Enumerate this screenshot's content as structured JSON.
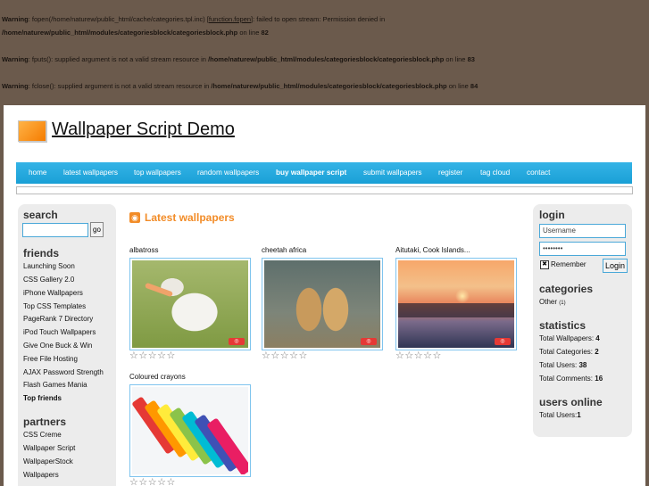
{
  "warnings": [
    {
      "label": "Warning",
      "text1": ": fopen(/home/naturew/public_html/cache/categories.tpl.inc) [",
      "link": "function.fopen",
      "text2": "]: failed to open stream: Permission denied in",
      "path": "/home/naturew/public_html/modules/categoriesblock/categoriesblock.php",
      "line_text": " on line ",
      "line": "82"
    },
    {
      "label": "Warning",
      "text1": ": fputs(): supplied argument is not a valid stream resource in ",
      "path": "/home/naturew/public_html/modules/categoriesblock/categoriesblock.php",
      "line_text": " on line ",
      "line": "83"
    },
    {
      "label": "Warning",
      "text1": ": fclose(): supplied argument is not a valid stream resource in ",
      "path": "/home/naturew/public_html/modules/categoriesblock/categoriesblock.php",
      "line_text": " on line ",
      "line": "84"
    }
  ],
  "site_title": "Wallpaper Script Demo",
  "nav": [
    "home",
    "latest wallpapers",
    "top wallpapers",
    "random wallpapers",
    "buy wallpaper script",
    "submit wallpapers",
    "register",
    "tag cloud",
    "contact"
  ],
  "left": {
    "search_heading": "search",
    "go_label": "go",
    "friends_heading": "friends",
    "friends": [
      "Launching Soon",
      "CSS Gallery 2.0",
      "iPhone Wallpapers",
      "Top CSS Templates",
      "PageRank 7 Directory",
      "iPod Touch Wallpapers",
      "Give One Buck & Win",
      "Free File Hosting",
      "AJAX Password Strength",
      "Flash Games Mania",
      "Top friends"
    ],
    "partners_heading": "partners",
    "partners": [
      "CSS Creme",
      "Wallpaper Script",
      "WallpaperStock",
      "Wallpapers"
    ]
  },
  "main": {
    "title": "Latest wallpapers",
    "rss_icon": "rss-icon",
    "wallpapers": [
      {
        "title": "albatross",
        "rating_stars": "☆☆☆☆☆"
      },
      {
        "title": "cheetah africa",
        "rating_stars": "☆☆☆☆☆"
      },
      {
        "title": "Aitutaki, Cook Islands...",
        "rating_stars": "☆☆☆☆☆"
      },
      {
        "title": "Coloured crayons",
        "rating_stars": "☆☆☆☆☆"
      }
    ]
  },
  "right": {
    "login_heading": "login",
    "username_value": "Username",
    "password_value": "••••••••",
    "checkbox_mark": "✖",
    "remember_label": "Remember",
    "login_button": "Login",
    "categories_heading": "categories",
    "category": {
      "name": "Other",
      "count": "(1)"
    },
    "statistics_heading": "statistics",
    "stats": [
      {
        "label": "Total Wallpapers: ",
        "value": "4"
      },
      {
        "label": "Total Categories: ",
        "value": "2"
      },
      {
        "label": "Total Users: ",
        "value": "38"
      },
      {
        "label": "Total Comments: ",
        "value": "16"
      }
    ],
    "users_online_heading": "users online",
    "users_online": {
      "label": "Total Users:",
      "value": "1"
    }
  },
  "crayon_colors": [
    "#e53935",
    "#ff9800",
    "#ffeb3b",
    "#8bc34a",
    "#00bcd4",
    "#3f51b5",
    "#e91e63"
  ]
}
